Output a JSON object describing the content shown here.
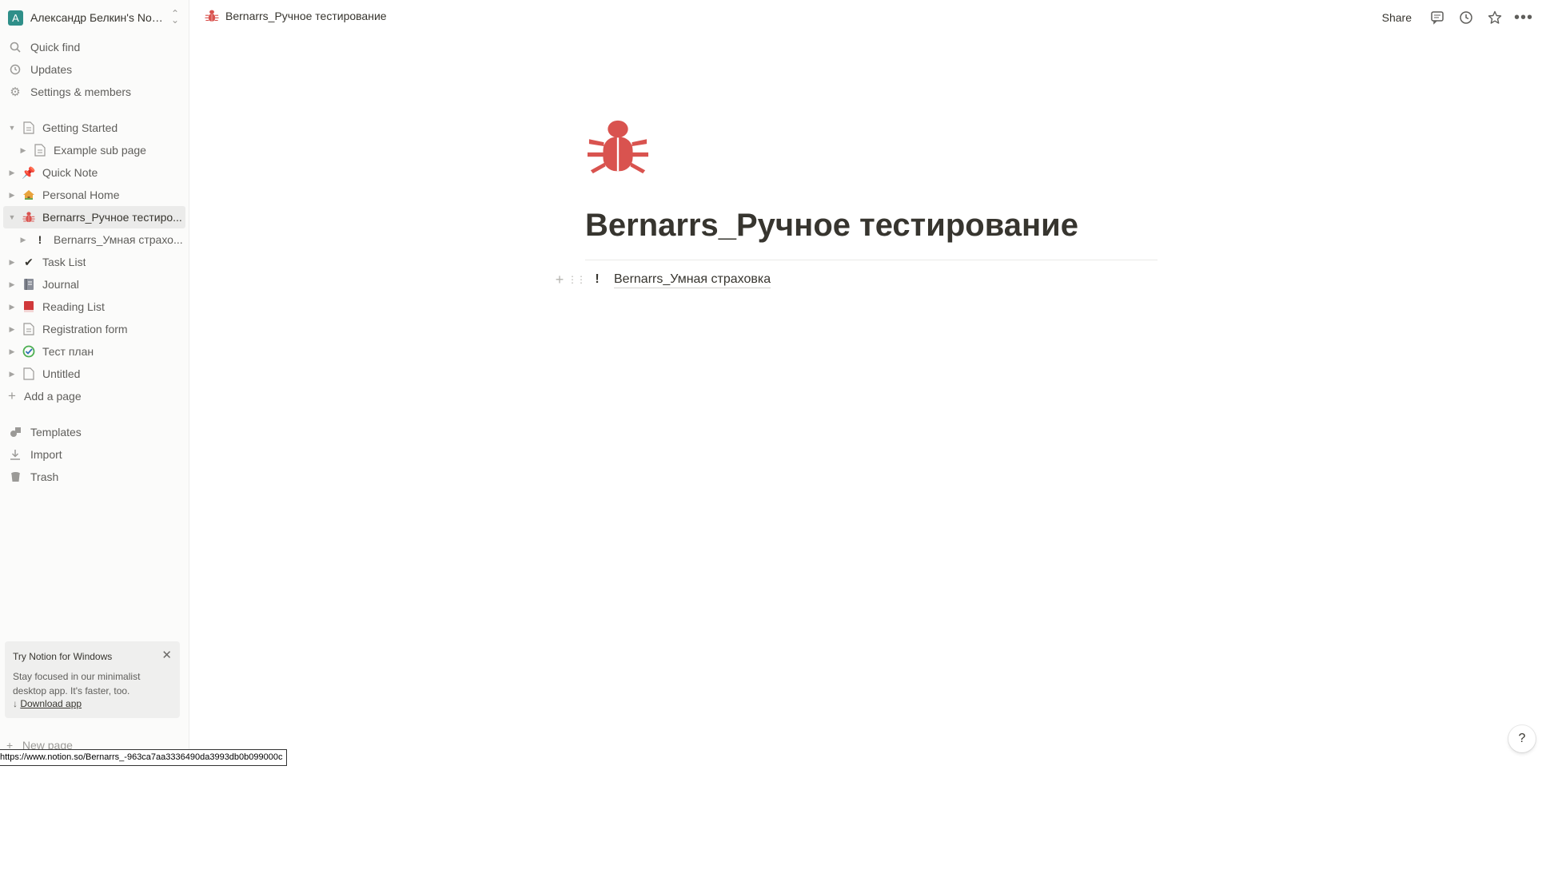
{
  "workspace": {
    "avatar_letter": "А",
    "name": "Александр Белкин's Not..."
  },
  "nav": {
    "quick_find": "Quick find",
    "updates": "Updates",
    "settings": "Settings & members"
  },
  "pages": [
    {
      "label": "Getting Started",
      "icon": "page-icon"
    },
    {
      "label": "Example sub page",
      "icon": "page-icon"
    },
    {
      "label": "Quick Note",
      "icon": "pushpin-icon"
    },
    {
      "label": "Personal Home",
      "icon": "house-icon"
    },
    {
      "label": "Bernarrs_Ручное тестиро...",
      "icon": "bug-icon"
    },
    {
      "label": "Bernarrs_Умная страхо...",
      "icon": "exclamation-icon"
    },
    {
      "label": "Task List",
      "icon": "checkmark-icon"
    },
    {
      "label": "Journal",
      "icon": "notebook-icon"
    },
    {
      "label": "Reading List",
      "icon": "book-icon"
    },
    {
      "label": "Registration form",
      "icon": "page-icon"
    },
    {
      "label": "Тест план",
      "icon": "check-circle-icon"
    },
    {
      "label": "Untitled",
      "icon": "page-icon"
    }
  ],
  "add_page": "Add a page",
  "bottom_nav": {
    "templates": "Templates",
    "import": "Import",
    "trash": "Trash"
  },
  "promo": {
    "title": "Try Notion for Windows",
    "desc": "Stay focused in our minimalist desktop app. It's faster, too.",
    "arrow": "↓",
    "download": "Download app"
  },
  "new_page": "New page",
  "topbar": {
    "breadcrumb": "Bernarrs_Ручное тестирование",
    "share": "Share"
  },
  "main": {
    "title": "Bernarrs_Ручное тестирование",
    "block_icon": "!",
    "block_link": "Bernarrs_Умная страховка"
  },
  "help": "?",
  "status_url": "https://www.notion.so/Bernarrs_-963ca7aa3336490da3993db0b099000c",
  "colors": {
    "accent": "#2f8f89",
    "bug": "#d9534f",
    "sidebar_bg": "#fbfbfa"
  }
}
